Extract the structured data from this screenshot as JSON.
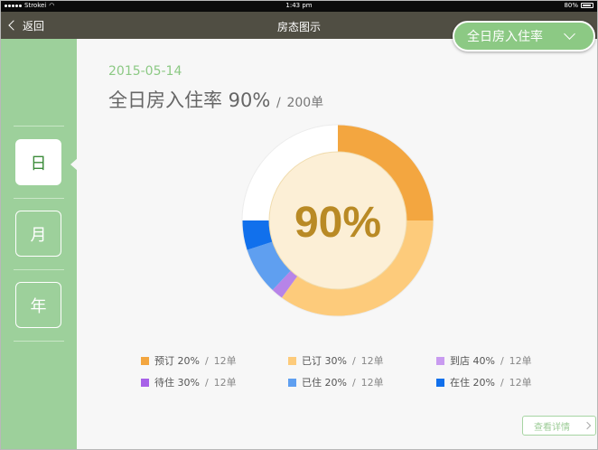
{
  "status_bar": {
    "carrier": "Strokei",
    "time": "1:43 pm",
    "battery": "80%"
  },
  "nav": {
    "back_label": "返回",
    "title": "房态图示"
  },
  "filter": {
    "label": "全日房入住率"
  },
  "sidebar": {
    "items": [
      {
        "label": "日",
        "active": true
      },
      {
        "label": "月",
        "active": false
      },
      {
        "label": "年",
        "active": false
      }
    ]
  },
  "summary": {
    "date": "2015-05-14",
    "title": "全日房入住率 90%",
    "separator": "/",
    "total": "200单"
  },
  "chart_data": {
    "type": "pie",
    "center_label": "90%",
    "ring_values": [
      25,
      35,
      2,
      8,
      5,
      25
    ],
    "ring_colors": [
      "#f3a640",
      "#fdcb7b",
      "#b784e8",
      "#5f9ff0",
      "#1170ec",
      "#ffffff"
    ],
    "inner_fill": "#fcefd6",
    "center_label_color": "#b98a25",
    "legend": [
      {
        "label": "预订 20%",
        "count": "12单",
        "color": "#f3a640"
      },
      {
        "label": "已订 30%",
        "count": "12单",
        "color": "#fdcb7b"
      },
      {
        "label": "到店 40%",
        "count": "12单",
        "color": "#c99bf0"
      },
      {
        "label": "待住 30%",
        "count": "12单",
        "color": "#a761e8"
      },
      {
        "label": "已住 20%",
        "count": "12单",
        "color": "#5f9ff0"
      },
      {
        "label": "在住 20%",
        "count": "12单",
        "color": "#1170ec"
      }
    ],
    "legend_separator": "/"
  },
  "footer": {
    "detail_label": "查看详情"
  },
  "colors": {
    "accent_green": "#8cc984",
    "nav_bg": "#504e43",
    "sidebar_bg": "#9dd09b"
  }
}
